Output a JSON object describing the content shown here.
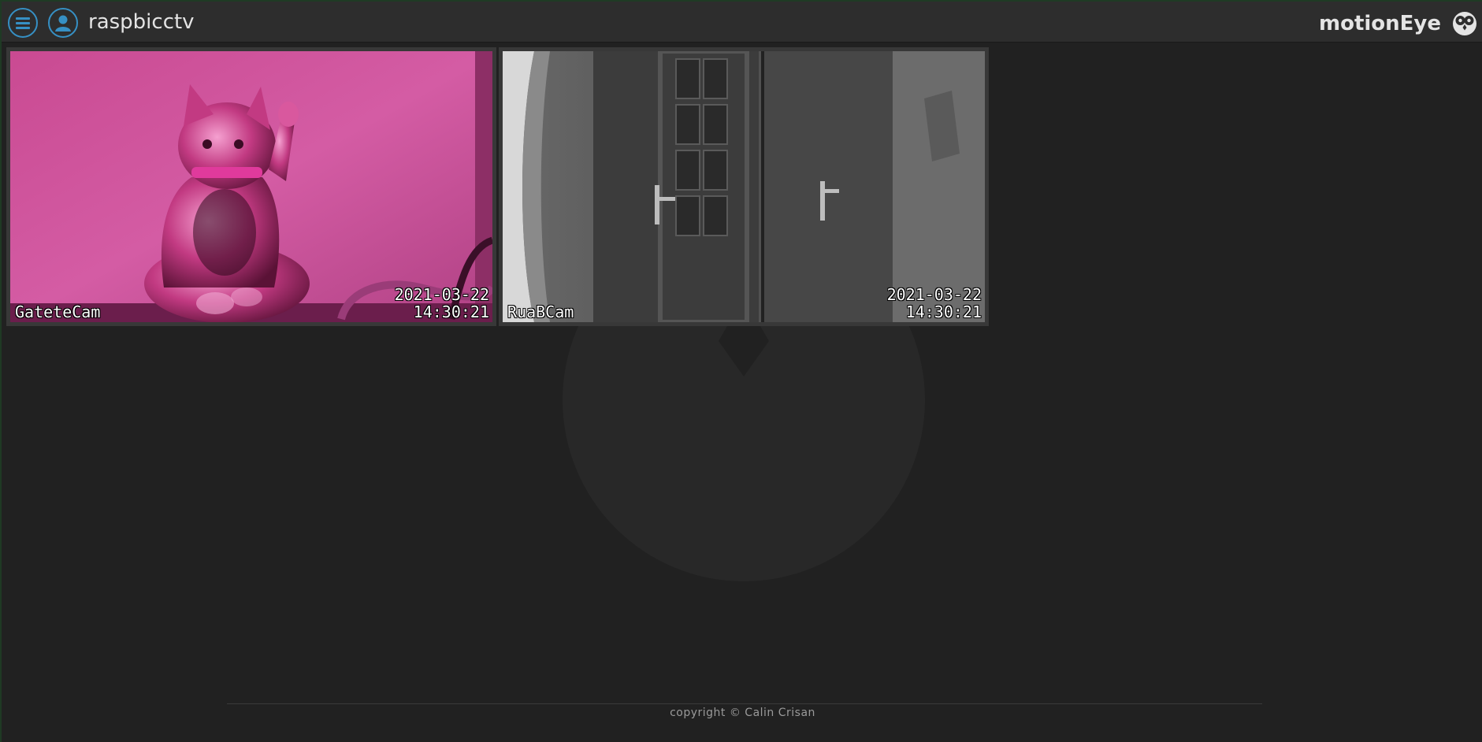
{
  "header": {
    "menu_icon": "hamburger-menu-icon",
    "user_icon": "user-icon",
    "device_name": "raspbicctv",
    "brand": "motionEye",
    "brand_icon": "owl-logo-icon",
    "accent_color": "#3690c4"
  },
  "cameras": [
    {
      "name": "GateteCam",
      "date": "2021-03-22",
      "time": "14:30:21"
    },
    {
      "name": "RuaBCam",
      "date": "2021-03-22",
      "time": "14:30:21"
    }
  ],
  "footer": {
    "copyright": "copyright © Calin Crisan"
  }
}
